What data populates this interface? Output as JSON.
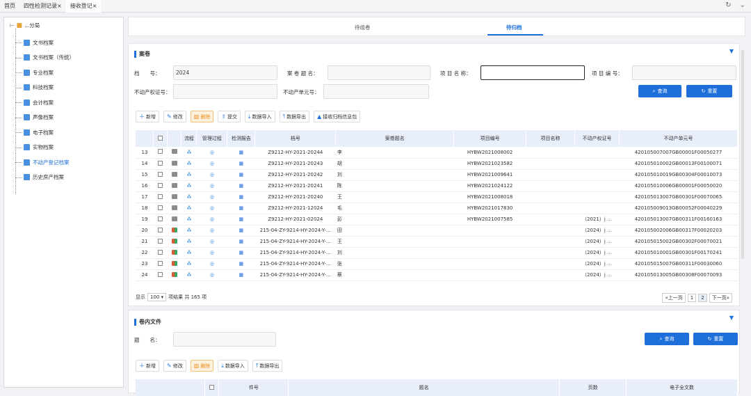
{
  "tabs": [
    {
      "label": "首页"
    },
    {
      "label": "四性检测记录×"
    },
    {
      "label": "接收登记×"
    }
  ],
  "topbar_icons": [
    "refresh-icon",
    "chevron-down-icon"
  ],
  "tree": {
    "root_label": "...分局",
    "items": [
      {
        "label": "文书档案"
      },
      {
        "label": "文书档案（传统）"
      },
      {
        "label": "专业档案"
      },
      {
        "label": "科技档案"
      },
      {
        "label": "会计档案"
      },
      {
        "label": "声像档案"
      },
      {
        "label": "电子档案"
      },
      {
        "label": "实物档案"
      },
      {
        "label": "不动产登记档案"
      },
      {
        "label": "历史房产档案"
      }
    ]
  },
  "nav": {
    "pending_volume": "待组卷",
    "pending_archive": "待归档"
  },
  "case_section": {
    "title": "案卷",
    "labels": {
      "archive_no": "档　　号：",
      "case_title": "案 卷 题 名：",
      "project_name": "项 目 名 称：",
      "project_no": "项 目 编 号：",
      "property_cert": "不动产权证号：",
      "property_unit": "不动产单元号："
    },
    "values": {
      "archive_no": "2024"
    },
    "buttons": {
      "query": "查询",
      "reset": "重置"
    },
    "toolbar": {
      "add": "新增",
      "edit": "修改",
      "delete": "删除",
      "submit": "提交",
      "import": "数据导入",
      "export": "数据导出",
      "receive": "接收归档信息包"
    },
    "columns": [
      "流程",
      "管理过程",
      "检测报告",
      "档号",
      "案卷题名",
      "项目编号",
      "项目名称",
      "不动产权证号",
      "不动产单元号"
    ],
    "rows": [
      {
        "n": "13",
        "archive": "Z9212-HY-2021-20244",
        "title": "李",
        "pno": "HYBW2021008002",
        "cert": "",
        "unit": "420105007007GB00001F00050277"
      },
      {
        "n": "14",
        "archive": "Z9212-HY-2021-20243",
        "title": "胡",
        "pno": "HYBW2021023582",
        "cert": "",
        "unit": "420105010002GB00013F00100071"
      },
      {
        "n": "15",
        "archive": "Z9212-HY-2021-20242",
        "title": "刘",
        "pno": "HYBW2021009641",
        "cert": "",
        "unit": "420105010019GB00304F00010073"
      },
      {
        "n": "16",
        "archive": "Z9212-HY-2021-20241",
        "title": "陈",
        "pno": "HYBW2021024122",
        "cert": "",
        "unit": "420105010006GB00001F00050020"
      },
      {
        "n": "17",
        "archive": "Z9212-HY-2021-20240",
        "title": "王",
        "pno": "HYBW2021008018",
        "cert": "",
        "unit": "420105013007GB00301F00070065"
      },
      {
        "n": "18",
        "archive": "Z9212-HY-2021-12024",
        "title": "毛",
        "pno": "HYBW2021017830",
        "cert": "",
        "unit": "420105009013GB00052F00040229"
      },
      {
        "n": "19",
        "archive": "Z9212-HY-2021-02024",
        "title": "彭",
        "pno": "HYBW2021007585",
        "cert": "（2021）j …",
        "unit": "420105013007GB00311F00160163"
      },
      {
        "n": "20",
        "archive": "215-04-ZY-9214-HY-2024-Y-…",
        "title": "田",
        "pno": "",
        "cert": "（2024）j …",
        "unit": "420105002006GB00317F00020203"
      },
      {
        "n": "21",
        "archive": "215-04-ZY-9214-HY-2024-Y-…",
        "title": "王",
        "pno": "",
        "cert": "（2024）j …",
        "unit": "420105015002GB00302F00070021"
      },
      {
        "n": "22",
        "archive": "215-04-ZY-9214-HY-2024-Y-…",
        "title": "刘",
        "pno": "",
        "cert": "（2024）j …",
        "unit": "420105010001GB00301F00170241"
      },
      {
        "n": "23",
        "archive": "215-04-ZY-9214-HY-2024-Y-…",
        "title": "张",
        "pno": "",
        "cert": "（2024）j …",
        "unit": "420105015007GB00311F00030060"
      },
      {
        "n": "24",
        "archive": "215-04-ZY-9214-HY-2024-Y-…",
        "title": "蔡",
        "pno": "",
        "cert": "（2024）j …",
        "unit": "420105013005GB00308F00070093"
      }
    ],
    "pager": {
      "show": "显示",
      "size": "100",
      "suffix": "项结果 共 165 项",
      "prev": "«上一页",
      "p1": "1",
      "p2": "2",
      "next": "下一页»"
    }
  },
  "inner_section": {
    "title": "卷内文件",
    "labels": {
      "title": "题　　名："
    },
    "buttons": {
      "query": "查询",
      "reset": "重置"
    },
    "toolbar": {
      "add": "新增",
      "edit": "修改",
      "delete": "删除",
      "import": "数据导入",
      "export": "数据导出"
    },
    "columns": [
      "件号",
      "题名",
      "页数",
      "电子全文数"
    ]
  }
}
